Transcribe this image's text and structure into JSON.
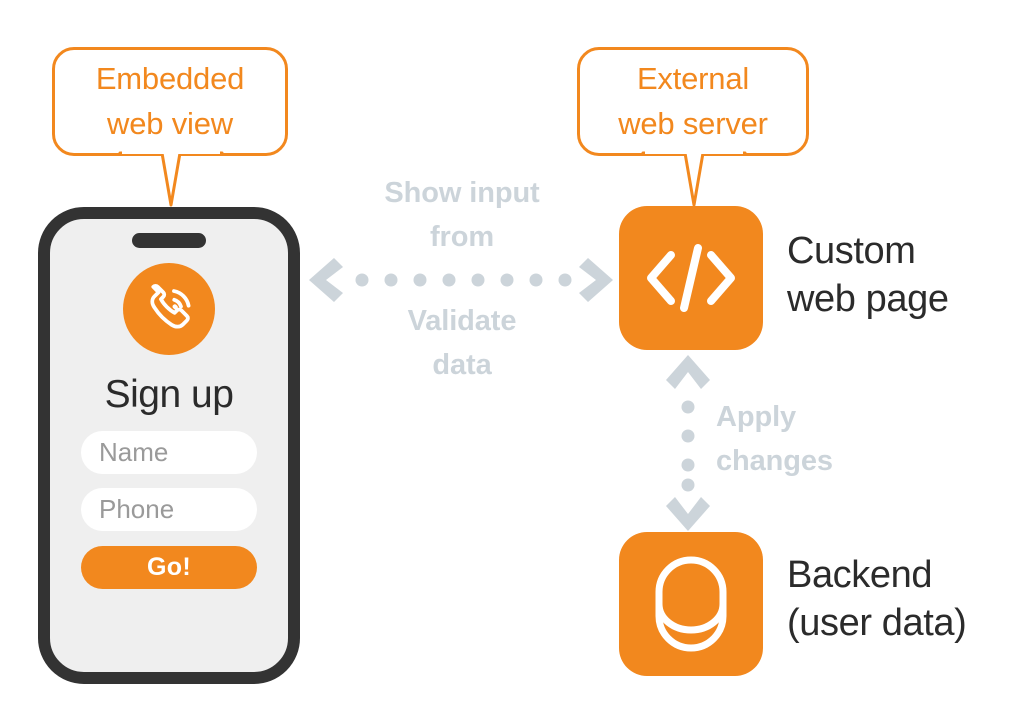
{
  "colors": {
    "orange": "#F2881E",
    "dark": "#333333",
    "text_dark": "#2B2B2B",
    "flow_gray": "#CCD4DA",
    "placeholder_gray": "#9A9A9A",
    "screen_bg": "#EFEFEF",
    "page_bg": "#FFFFFF"
  },
  "callouts": {
    "left": {
      "label": "Embedded\nweb  view",
      "icon": "speech-bubble"
    },
    "right": {
      "label": "External\nweb server",
      "icon": "speech-bubble"
    }
  },
  "phone": {
    "app_logo_icon": "phone-call-icon",
    "title": "Sign up",
    "fields": [
      {
        "name": "name",
        "placeholder": "Name",
        "value": ""
      },
      {
        "name": "phone",
        "placeholder": "Phone",
        "value": ""
      }
    ],
    "submit_label": "Go!"
  },
  "nodes": [
    {
      "id": "custom-web-page",
      "icon": "code-brackets-icon",
      "label": "Custom\nweb page"
    },
    {
      "id": "backend",
      "icon": "database-cylinder-icon",
      "label": "Backend\n(user data)"
    }
  ],
  "connectors": [
    {
      "id": "phone-to-web",
      "orientation": "horizontal",
      "direction": "bidirectional",
      "dots": 8,
      "label_above": "Show input\nfrom",
      "label_below": "Validate\ndata"
    },
    {
      "id": "web-to-backend",
      "orientation": "vertical",
      "direction": "bidirectional",
      "dots": 4,
      "label_side": "Apply\nchanges"
    }
  ]
}
